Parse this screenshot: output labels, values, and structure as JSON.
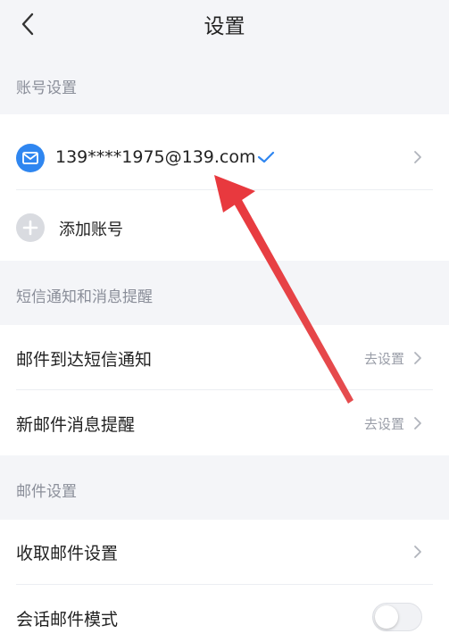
{
  "header": {
    "title": "设置",
    "back_icon": "chevron-left-icon"
  },
  "sections": {
    "account": {
      "title": "账号设置"
    },
    "sms": {
      "title": "短信通知和消息提醒"
    },
    "mail": {
      "title": "邮件设置"
    }
  },
  "account": {
    "email": "139****1975@139.com",
    "email_icon": "mail-icon",
    "verified_icon": "checkmark-icon",
    "add_label": "添加账号",
    "add_icon": "plus-icon"
  },
  "sms": {
    "mail_arrival_label": "邮件到达短信通知",
    "mail_arrival_action": "去设置",
    "new_mail_label": "新邮件消息提醒",
    "new_mail_action": "去设置"
  },
  "mail": {
    "receive_label": "收取邮件设置",
    "conversation_label": "会话邮件模式",
    "conversation_enabled": false
  },
  "colors": {
    "accent": "#2f86f0",
    "annotation_arrow": "#e8393e"
  }
}
